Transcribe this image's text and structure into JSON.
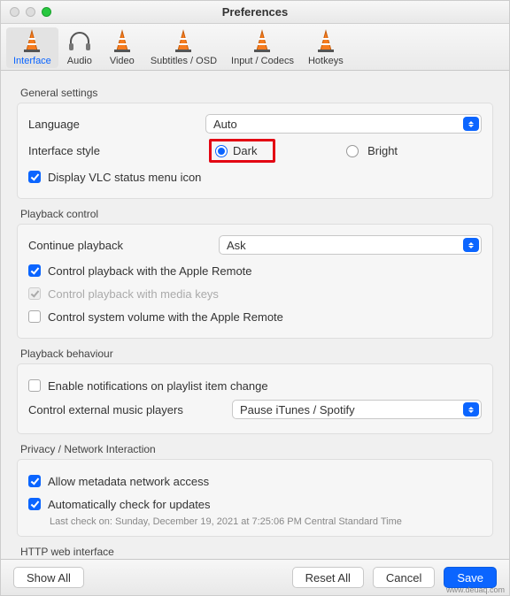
{
  "window": {
    "title": "Preferences"
  },
  "toolbar": {
    "items": [
      {
        "label": "Interface"
      },
      {
        "label": "Audio"
      },
      {
        "label": "Video"
      },
      {
        "label": "Subtitles / OSD"
      },
      {
        "label": "Input / Codecs"
      },
      {
        "label": "Hotkeys"
      }
    ]
  },
  "general": {
    "section_label": "General settings",
    "language_label": "Language",
    "language_value": "Auto",
    "interface_style_label": "Interface style",
    "dark_label": "Dark",
    "bright_label": "Bright",
    "display_status_menu": "Display VLC status menu icon"
  },
  "playback_control": {
    "section_label": "Playback control",
    "continue_label": "Continue playback",
    "continue_value": "Ask",
    "apple_remote": "Control playback with the Apple Remote",
    "media_keys": "Control playback with media keys",
    "system_volume": "Control system volume with the Apple Remote"
  },
  "playback_behaviour": {
    "section_label": "Playback behaviour",
    "notifications": "Enable notifications on playlist item change",
    "external_players_label": "Control external music players",
    "external_players_value": "Pause iTunes / Spotify"
  },
  "privacy": {
    "section_label": "Privacy / Network Interaction",
    "metadata": "Allow metadata network access",
    "updates": "Automatically check for updates",
    "last_check": "Last check on: Sunday, December 19, 2021 at 7:25:06 PM Central Standard Time"
  },
  "http": {
    "section_label": "HTTP web interface"
  },
  "footer": {
    "show_all": "Show All",
    "reset_all": "Reset All",
    "cancel": "Cancel",
    "save": "Save"
  },
  "watermark": "www.deuaq.com"
}
